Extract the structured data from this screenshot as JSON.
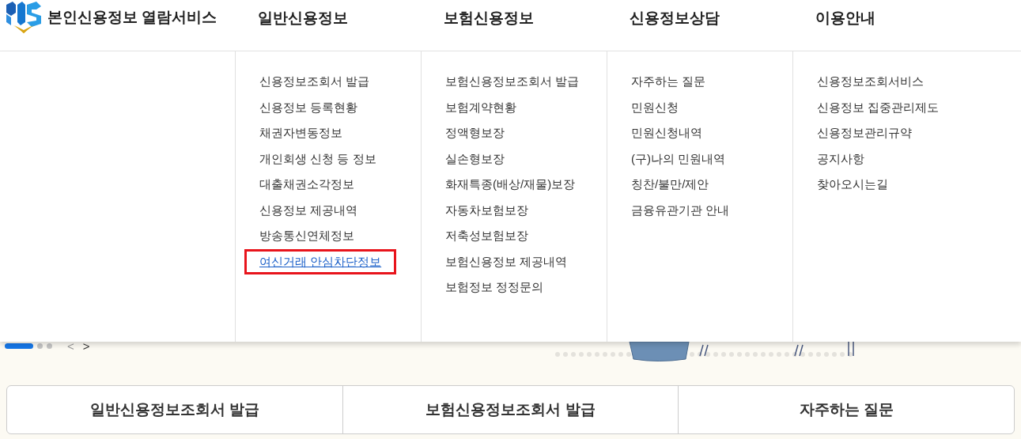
{
  "logo": {
    "title": "본인신용정보 열람서비스"
  },
  "nav": [
    {
      "label": "일반신용정보",
      "items": [
        {
          "label": "신용정보조회서 발급",
          "selected": false
        },
        {
          "label": "신용정보 등록현황",
          "selected": false
        },
        {
          "label": "채권자변동정보",
          "selected": false
        },
        {
          "label": "개인회생 신청 등 정보",
          "selected": false
        },
        {
          "label": "대출채권소각정보",
          "selected": false
        },
        {
          "label": "신용정보 제공내역",
          "selected": false
        },
        {
          "label": "방송통신연체정보",
          "selected": false
        },
        {
          "label": "여신거래 안심차단정보",
          "selected": true
        }
      ]
    },
    {
      "label": "보험신용정보",
      "items": [
        {
          "label": "보험신용정보조회서 발급",
          "selected": false
        },
        {
          "label": "보험계약현황",
          "selected": false
        },
        {
          "label": "정액형보장",
          "selected": false
        },
        {
          "label": "실손형보장",
          "selected": false
        },
        {
          "label": "화재특종(배상/재물)보장",
          "selected": false
        },
        {
          "label": "자동차보험보장",
          "selected": false
        },
        {
          "label": "저축성보험보장",
          "selected": false
        },
        {
          "label": "보험신용정보 제공내역",
          "selected": false
        },
        {
          "label": "보험정보 정정문의",
          "selected": false
        }
      ]
    },
    {
      "label": "신용정보상담",
      "items": [
        {
          "label": "자주하는 질문",
          "selected": false
        },
        {
          "label": "민원신청",
          "selected": false
        },
        {
          "label": "민원신청내역",
          "selected": false
        },
        {
          "label": "(구)나의 민원내역",
          "selected": false
        },
        {
          "label": "칭찬/불만/제안",
          "selected": false
        },
        {
          "label": "금융유관기관 안내",
          "selected": false
        }
      ]
    },
    {
      "label": "이용안내",
      "items": [
        {
          "label": "신용정보조회서비스",
          "selected": false
        },
        {
          "label": "신용정보 집중관리제도",
          "selected": false
        },
        {
          "label": "신용정보관리규약",
          "selected": false
        },
        {
          "label": "공지사항",
          "selected": false
        },
        {
          "label": "찾아오시는길",
          "selected": false
        }
      ]
    }
  ],
  "carousel": {
    "slides": [
      {
        "selected": true
      },
      {
        "selected": false
      },
      {
        "selected": false
      }
    ],
    "prev": "<",
    "next": ">"
  },
  "quick_links": [
    "일반신용정보조회서 발급",
    "보험신용정보조회서 발급",
    "자주하는 질문"
  ]
}
